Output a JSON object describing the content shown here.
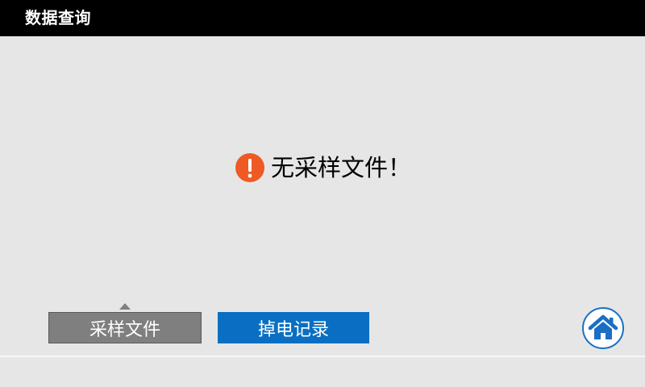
{
  "header": {
    "title": "数据查询"
  },
  "main": {
    "message": "无采样文件！",
    "alert_icon": "exclamation-circle-icon"
  },
  "tabs": [
    {
      "label": "采样文件",
      "selected": true
    },
    {
      "label": "掉电记录",
      "selected": false
    }
  ],
  "home_button": {
    "icon": "home-icon"
  },
  "colors": {
    "title_bar_bg": "#000000",
    "page_bg": "#e6e6e6",
    "alert": "#ee5a24",
    "tab_selected": "#7f7f7f",
    "tab_unselected": "#0a6fc2",
    "home_accent": "#1a6fc4"
  }
}
